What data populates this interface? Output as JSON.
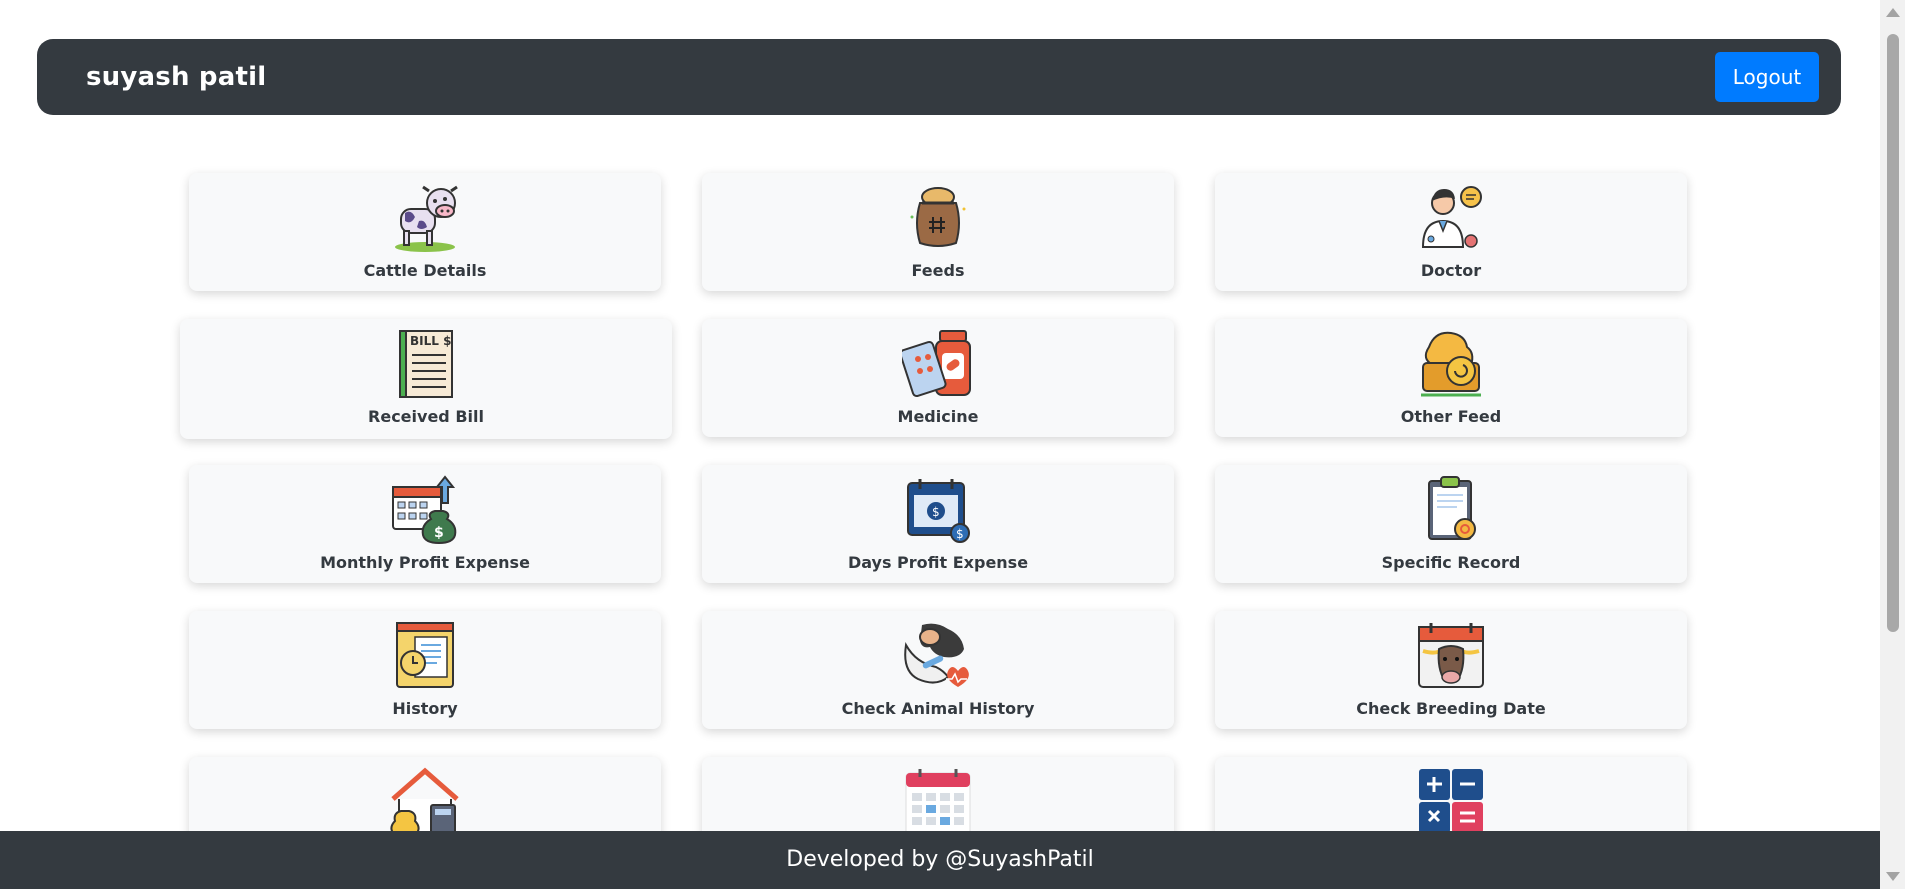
{
  "header": {
    "user_name": "suyash patil",
    "logout_label": "Logout"
  },
  "tiles": [
    {
      "label": "Cattle Details",
      "icon": "cow-icon"
    },
    {
      "label": "Feeds",
      "icon": "feed-sack-icon"
    },
    {
      "label": "Doctor",
      "icon": "doctor-icon"
    },
    {
      "label": "Received Bill",
      "icon": "bill-icon"
    },
    {
      "label": "Medicine",
      "icon": "medicine-icon"
    },
    {
      "label": "Other Feed",
      "icon": "hay-bale-icon"
    },
    {
      "label": "Monthly Profit Expense",
      "icon": "calendar-money-bag-icon"
    },
    {
      "label": "Days Profit Expense",
      "icon": "calendar-money-icon"
    },
    {
      "label": "Specific Record",
      "icon": "clipboard-icon"
    },
    {
      "label": "History",
      "icon": "history-folder-icon"
    },
    {
      "label": "Check Animal History",
      "icon": "animal-health-icon"
    },
    {
      "label": "Check Breeding Date",
      "icon": "cow-calendar-icon"
    },
    {
      "label": "",
      "icon": "house-money-icon"
    },
    {
      "label": "",
      "icon": "calendar-grid-icon"
    },
    {
      "label": "",
      "icon": "calculator-icon"
    }
  ],
  "footer": {
    "text": "Developed by @SuyashPatil"
  }
}
